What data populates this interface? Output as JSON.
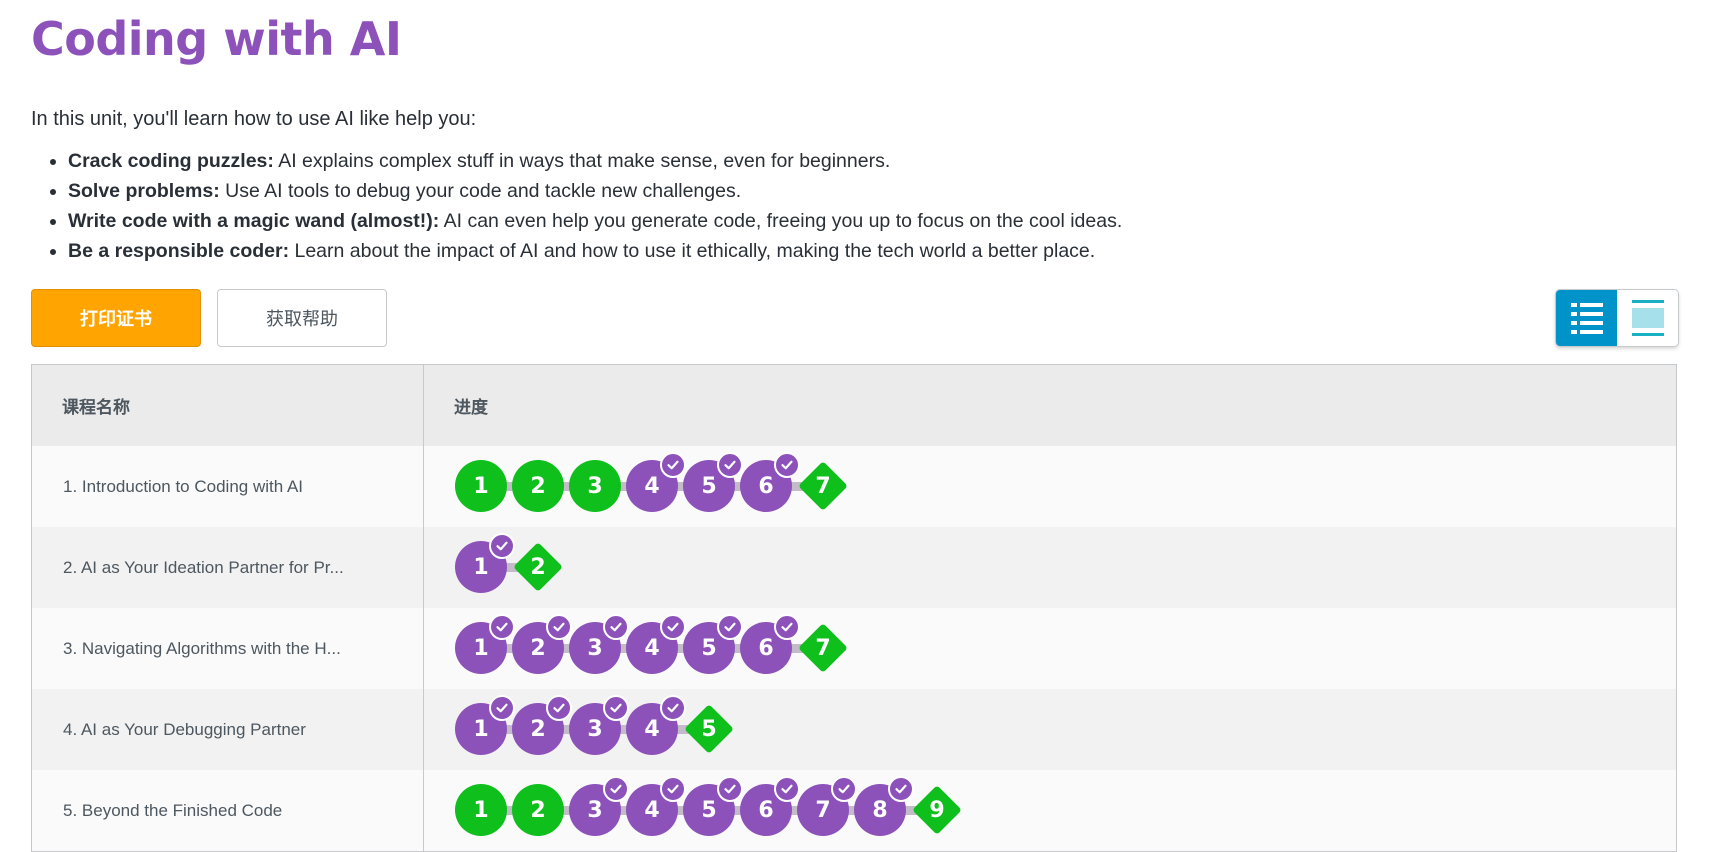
{
  "unit_title": "Coding with AI",
  "intro": "In this unit, you'll learn how to use AI like help you:",
  "bullets": [
    {
      "bold": "Crack coding puzzles:",
      "text": " AI explains complex stuff in ways that make sense, even for beginners."
    },
    {
      "bold": "Solve problems:",
      "text": " Use AI tools to debug your code and tackle new challenges."
    },
    {
      "bold": "Write code with a magic wand (almost!):",
      "text": " AI can even help you generate code, freeing you up to focus on the cool ideas."
    },
    {
      "bold": "Be a responsible coder:",
      "text": " Learn about the impact of AI and how to use it ethically, making the tech world a better place."
    }
  ],
  "buttons": {
    "print_certificate": "打印证书",
    "get_help": "获取帮助"
  },
  "view_toggle": {
    "detail_icon": "list-detail-icon",
    "summary_icon": "list-summary-icon",
    "active": "detail"
  },
  "table": {
    "headers": {
      "lesson_name": "课程名称",
      "progress": "进度"
    },
    "rows": [
      {
        "name": "1. Introduction to Coding with AI",
        "levels": [
          {
            "n": "1",
            "status": "green"
          },
          {
            "n": "2",
            "status": "green"
          },
          {
            "n": "3",
            "status": "green"
          },
          {
            "n": "4",
            "status": "purple",
            "checked": true
          },
          {
            "n": "5",
            "status": "purple",
            "checked": true
          },
          {
            "n": "6",
            "status": "purple",
            "checked": true
          },
          {
            "n": "7",
            "status": "diamond"
          }
        ]
      },
      {
        "name": "2. AI as Your Ideation Partner for Pr...",
        "levels": [
          {
            "n": "1",
            "status": "purple",
            "checked": true
          },
          {
            "n": "2",
            "status": "diamond"
          }
        ]
      },
      {
        "name": "3. Navigating Algorithms with the H...",
        "levels": [
          {
            "n": "1",
            "status": "purple",
            "checked": true
          },
          {
            "n": "2",
            "status": "purple",
            "checked": true
          },
          {
            "n": "3",
            "status": "purple",
            "checked": true
          },
          {
            "n": "4",
            "status": "purple",
            "checked": true
          },
          {
            "n": "5",
            "status": "purple",
            "checked": true
          },
          {
            "n": "6",
            "status": "purple",
            "checked": true
          },
          {
            "n": "7",
            "status": "diamond"
          }
        ]
      },
      {
        "name": "4. AI as Your Debugging Partner",
        "levels": [
          {
            "n": "1",
            "status": "purple",
            "checked": true
          },
          {
            "n": "2",
            "status": "purple",
            "checked": true
          },
          {
            "n": "3",
            "status": "purple",
            "checked": true
          },
          {
            "n": "4",
            "status": "purple",
            "checked": true
          },
          {
            "n": "5",
            "status": "diamond"
          }
        ]
      },
      {
        "name": "5. Beyond the Finished Code",
        "levels": [
          {
            "n": "1",
            "status": "green"
          },
          {
            "n": "2",
            "status": "green"
          },
          {
            "n": "3",
            "status": "purple",
            "checked": true
          },
          {
            "n": "4",
            "status": "purple",
            "checked": true
          },
          {
            "n": "5",
            "status": "purple",
            "checked": true
          },
          {
            "n": "6",
            "status": "purple",
            "checked": true
          },
          {
            "n": "7",
            "status": "purple",
            "checked": true
          },
          {
            "n": "8",
            "status": "purple",
            "checked": true
          },
          {
            "n": "9",
            "status": "diamond"
          }
        ]
      }
    ]
  },
  "colors": {
    "title": "#8c52ba",
    "green": "#0fbf1c",
    "purple": "#8c52ba",
    "orange": "#ffa400",
    "toggle_active": "#0093c9"
  }
}
